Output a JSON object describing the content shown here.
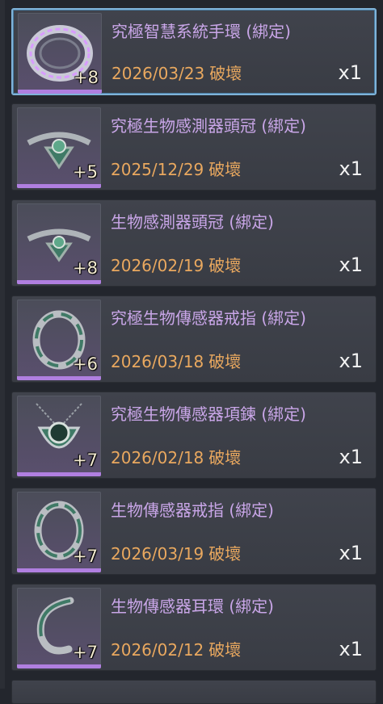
{
  "colors": {
    "name": "#c9a6e8",
    "date": "#e9a85f",
    "level": "#f3ead0",
    "rarity_bar": "#b07fe0",
    "selected_border": "#7fb3d9"
  },
  "items": [
    {
      "name": "究極智慧系統手環 (綁定)",
      "level": "+8",
      "date": "2026/03/23",
      "status": "破壞",
      "qty": "x1",
      "icon": "bracelet-icon",
      "selected": true
    },
    {
      "name": "究極生物感測器頭冠 (綁定)",
      "level": "+5",
      "date": "2025/12/29",
      "status": "破壞",
      "qty": "x1",
      "icon": "circlet-icon",
      "selected": false
    },
    {
      "name": "生物感測器頭冠 (綁定)",
      "level": "+8",
      "date": "2026/02/19",
      "status": "破壞",
      "qty": "x1",
      "icon": "circlet-icon",
      "selected": false
    },
    {
      "name": "究極生物傳感器戒指 (綁定)",
      "level": "+6",
      "date": "2026/03/18",
      "status": "破壞",
      "qty": "x1",
      "icon": "ring-icon",
      "selected": false
    },
    {
      "name": "究極生物傳感器項鍊 (綁定)",
      "level": "+7",
      "date": "2026/02/18",
      "status": "破壞",
      "qty": "x1",
      "icon": "necklace-icon",
      "selected": false
    },
    {
      "name": "生物傳感器戒指 (綁定)",
      "level": "+7",
      "date": "2026/03/19",
      "status": "破壞",
      "qty": "x1",
      "icon": "ring-icon",
      "selected": false
    },
    {
      "name": "生物傳感器耳環 (綁定)",
      "level": "+7",
      "date": "2026/02/12",
      "status": "破壞",
      "qty": "x1",
      "icon": "earring-icon",
      "selected": false
    }
  ]
}
